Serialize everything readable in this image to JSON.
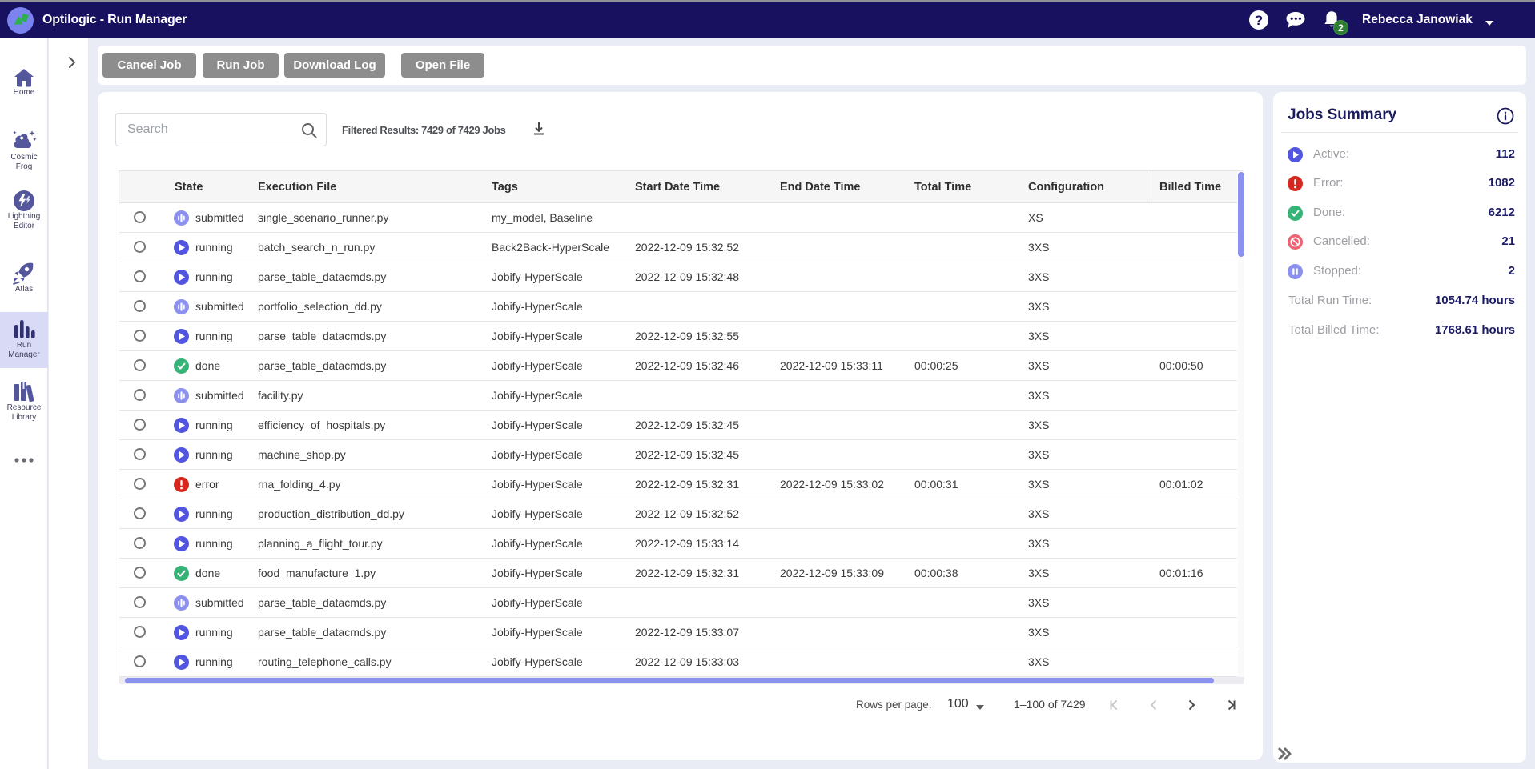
{
  "topbar": {
    "title": "Optilogic - Run Manager",
    "user": "Rebecca Janowiak",
    "notification_count": "2"
  },
  "sidebar": {
    "items": [
      {
        "id": "home",
        "lines": [
          "Home"
        ]
      },
      {
        "id": "cosmic-frog",
        "lines": [
          "Cosmic",
          "Frog"
        ]
      },
      {
        "id": "lightning-editor",
        "lines": [
          "Lightning",
          "Editor"
        ]
      },
      {
        "id": "atlas",
        "lines": [
          "Atlas"
        ]
      },
      {
        "id": "run-manager",
        "lines": [
          "Run",
          "Manager"
        ],
        "active": true
      },
      {
        "id": "resource-library",
        "lines": [
          "Resource",
          "Library"
        ]
      },
      {
        "id": "more",
        "lines": []
      }
    ]
  },
  "toolbar": {
    "buttons": [
      "Cancel Job",
      "Run Job",
      "Download Log",
      "Open File"
    ]
  },
  "search": {
    "placeholder": "Search"
  },
  "filter_summary": "Filtered Results: 7429 of 7429 Jobs",
  "table": {
    "columns": [
      "State",
      "Execution File",
      "Tags",
      "Start Date Time",
      "End Date Time",
      "Total Time",
      "Configuration",
      "Billed Time"
    ],
    "rows": [
      {
        "state": "submitted",
        "file": "single_scenario_runner.py",
        "tags": "my_model, Baseline",
        "start": "",
        "end": "",
        "total": "",
        "config": "XS",
        "billed": ""
      },
      {
        "state": "running",
        "file": "batch_search_n_run.py",
        "tags": "Back2Back-HyperScale",
        "start": "2022-12-09 15:32:52",
        "end": "",
        "total": "",
        "config": "3XS",
        "billed": ""
      },
      {
        "state": "running",
        "file": "parse_table_datacmds.py",
        "tags": "Jobify-HyperScale",
        "start": "2022-12-09 15:32:48",
        "end": "",
        "total": "",
        "config": "3XS",
        "billed": ""
      },
      {
        "state": "submitted",
        "file": "portfolio_selection_dd.py",
        "tags": "Jobify-HyperScale",
        "start": "",
        "end": "",
        "total": "",
        "config": "3XS",
        "billed": ""
      },
      {
        "state": "running",
        "file": "parse_table_datacmds.py",
        "tags": "Jobify-HyperScale",
        "start": "2022-12-09 15:32:55",
        "end": "",
        "total": "",
        "config": "3XS",
        "billed": ""
      },
      {
        "state": "done",
        "file": "parse_table_datacmds.py",
        "tags": "Jobify-HyperScale",
        "start": "2022-12-09 15:32:46",
        "end": "2022-12-09 15:33:11",
        "total": "00:00:25",
        "config": "3XS",
        "billed": "00:00:50"
      },
      {
        "state": "submitted",
        "file": "facility.py",
        "tags": "Jobify-HyperScale",
        "start": "",
        "end": "",
        "total": "",
        "config": "3XS",
        "billed": ""
      },
      {
        "state": "running",
        "file": "efficiency_of_hospitals.py",
        "tags": "Jobify-HyperScale",
        "start": "2022-12-09 15:32:45",
        "end": "",
        "total": "",
        "config": "3XS",
        "billed": ""
      },
      {
        "state": "running",
        "file": "machine_shop.py",
        "tags": "Jobify-HyperScale",
        "start": "2022-12-09 15:32:45",
        "end": "",
        "total": "",
        "config": "3XS",
        "billed": ""
      },
      {
        "state": "error",
        "file": "rna_folding_4.py",
        "tags": "Jobify-HyperScale",
        "start": "2022-12-09 15:32:31",
        "end": "2022-12-09 15:33:02",
        "total": "00:00:31",
        "config": "3XS",
        "billed": "00:01:02"
      },
      {
        "state": "running",
        "file": "production_distribution_dd.py",
        "tags": "Jobify-HyperScale",
        "start": "2022-12-09 15:32:52",
        "end": "",
        "total": "",
        "config": "3XS",
        "billed": ""
      },
      {
        "state": "running",
        "file": "planning_a_flight_tour.py",
        "tags": "Jobify-HyperScale",
        "start": "2022-12-09 15:33:14",
        "end": "",
        "total": "",
        "config": "3XS",
        "billed": ""
      },
      {
        "state": "done",
        "file": "food_manufacture_1.py",
        "tags": "Jobify-HyperScale",
        "start": "2022-12-09 15:32:31",
        "end": "2022-12-09 15:33:09",
        "total": "00:00:38",
        "config": "3XS",
        "billed": "00:01:16"
      },
      {
        "state": "submitted",
        "file": "parse_table_datacmds.py",
        "tags": "Jobify-HyperScale",
        "start": "",
        "end": "",
        "total": "",
        "config": "3XS",
        "billed": ""
      },
      {
        "state": "running",
        "file": "parse_table_datacmds.py",
        "tags": "Jobify-HyperScale",
        "start": "2022-12-09 15:33:07",
        "end": "",
        "total": "",
        "config": "3XS",
        "billed": ""
      },
      {
        "state": "running",
        "file": "routing_telephone_calls.py",
        "tags": "Jobify-HyperScale",
        "start": "2022-12-09 15:33:03",
        "end": "",
        "total": "",
        "config": "3XS",
        "billed": ""
      }
    ]
  },
  "pagination": {
    "rows_per_page_label": "Rows per page:",
    "rows_per_page": "100",
    "range": "1–100 of 7429"
  },
  "summary": {
    "title": "Jobs Summary",
    "rows": [
      {
        "icon": "active",
        "label": "Active:",
        "value": "112"
      },
      {
        "icon": "error",
        "label": "Error:",
        "value": "1082"
      },
      {
        "icon": "done",
        "label": "Done:",
        "value": "6212"
      },
      {
        "icon": "cancelled",
        "label": "Cancelled:",
        "value": "21"
      },
      {
        "icon": "stopped",
        "label": "Stopped:",
        "value": "2"
      }
    ],
    "totals": [
      {
        "label": "Total Run Time:",
        "value": "1054.74 hours"
      },
      {
        "label": "Total Billed Time:",
        "value": "1768.61 hours"
      }
    ]
  },
  "colors": {
    "topbar": "#171160",
    "accent_navy": "#1c1c66",
    "running": "#5155e0",
    "submitted": "#8c90ee",
    "done": "#36b376",
    "error": "#d6281e",
    "cancelled": "#ee6370",
    "badge": "#2e7d32",
    "scrollbar": "#8c90ee",
    "active_item_bg": "#d9dbf6"
  }
}
